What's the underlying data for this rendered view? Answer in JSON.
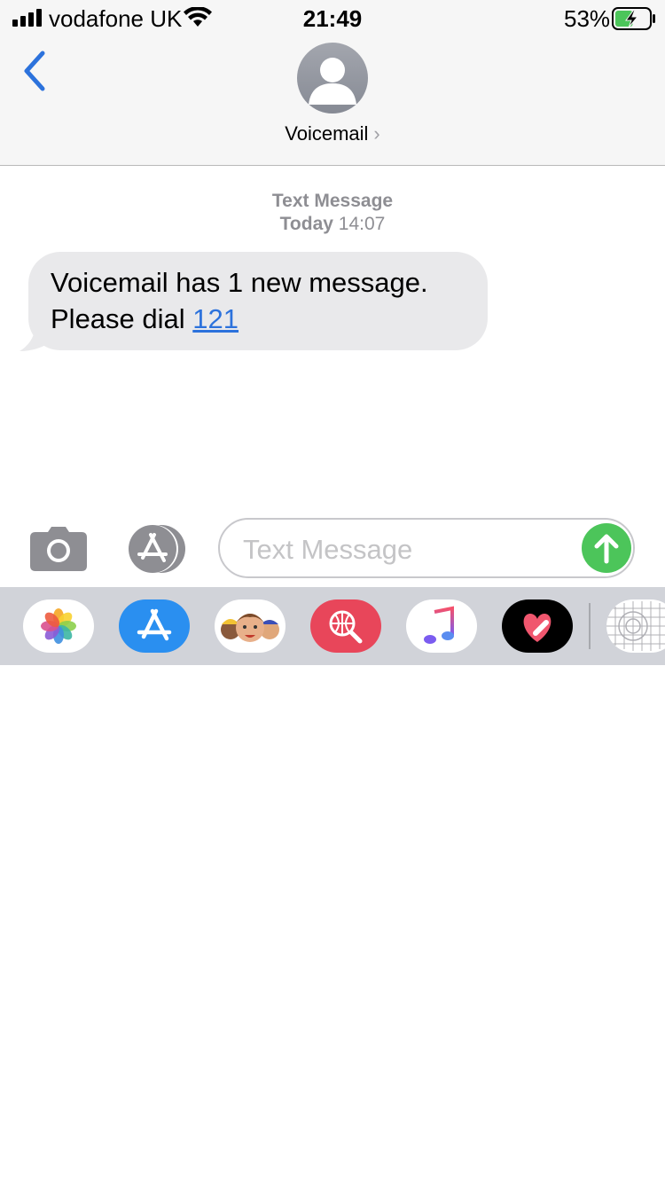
{
  "status_bar": {
    "carrier": "vodafone UK",
    "time": "21:49",
    "battery_percent": "53%",
    "battery_level": 0.53,
    "charging": true
  },
  "header": {
    "back_icon": "chevron-left-icon",
    "contact_name": "Voicemail",
    "contact_chevron": "›"
  },
  "conversation": {
    "service_label": "Text Message",
    "date_label": "Today",
    "time_label": "14:07",
    "messages": [
      {
        "line1": "Voicemail has 1 new message.",
        "line2_prefix": "Please dial ",
        "link_text": "121"
      }
    ]
  },
  "composer": {
    "placeholder": "Text Message",
    "camera_icon": "camera-icon",
    "apps_icon": "app-store-icon",
    "send_icon": "send-arrow-icon",
    "send_color": "#4cc55a"
  },
  "app_drawer": {
    "apps": [
      {
        "name": "photos",
        "icon": "photos-icon"
      },
      {
        "name": "app-store",
        "icon": "app-store-icon"
      },
      {
        "name": "memoji",
        "icon": "memoji-icon"
      },
      {
        "name": "image-search",
        "icon": "globe-search-icon"
      },
      {
        "name": "music",
        "icon": "music-note-icon"
      },
      {
        "name": "digital-touch",
        "icon": "heart-touch-icon"
      },
      {
        "name": "more",
        "icon": "grid-icon"
      }
    ]
  },
  "colors": {
    "accent_blue": "#2c72dc",
    "bubble_gray": "#e9e9eb",
    "meta_gray": "#8e8e93",
    "drawer_bg": "#d1d3d9"
  }
}
